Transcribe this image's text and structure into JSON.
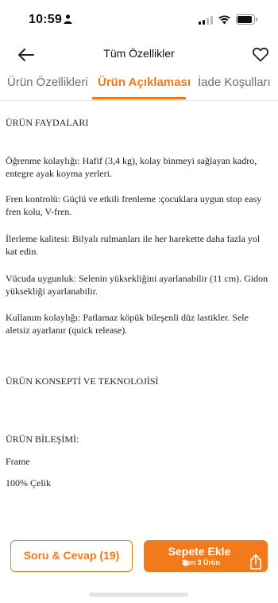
{
  "status_bar": {
    "time": "10:59"
  },
  "header": {
    "title": "Tüm Özellikler"
  },
  "tabs": [
    {
      "label": "Ürün Özellikleri"
    },
    {
      "label": "Ürün Açıklaması"
    },
    {
      "label": "İade Koşulları"
    }
  ],
  "content": {
    "benefits_heading": "ÜRÜN FAYDALARI",
    "p1": "Öğrenme kolaylığı: Hafif (3,4 kg), kolay binmeyi sağlayan kadro, entegre ayak koyma yerleri.",
    "p2": "Fren kontrolü: Güçlü ve etkili frenleme :çocuklara uygun stop easy fren kolu, V-fren.",
    "p3": "İlerleme kalitesi: Bilyalı rulmanları ile her harekette daha fazla yol kat edin.",
    "p4": "Vücuda uygunluk: Selenin yüksekliğini ayarlanabilir (11 cm). Gidon yüksekliği ayarlanabilir.",
    "p5": "Kullanım kolaylığı: Patlamaz köpük bileşenli düz lastikler. Sele aletsiz ayarlanır (quick release).",
    "concept_heading": "ÜRÜN KONSEPTİ VE TEKNOLOJİSİ",
    "components_heading": "ÜRÜN BİLEŞİMİ:",
    "frame_label": "Frame",
    "frame_value": "100% Çelik"
  },
  "bottom_bar": {
    "qa_button": "Soru & Cevap (19)",
    "cart_button": "Sepete Ekle",
    "cart_subtext": "Son 3 Ürün"
  },
  "colors": {
    "accent": "#f27a1a"
  },
  "icons": [
    "person-icon",
    "signal-icon",
    "wifi-icon",
    "battery-icon",
    "back-arrow-icon",
    "heart-icon",
    "timer-icon",
    "share-icon"
  ]
}
